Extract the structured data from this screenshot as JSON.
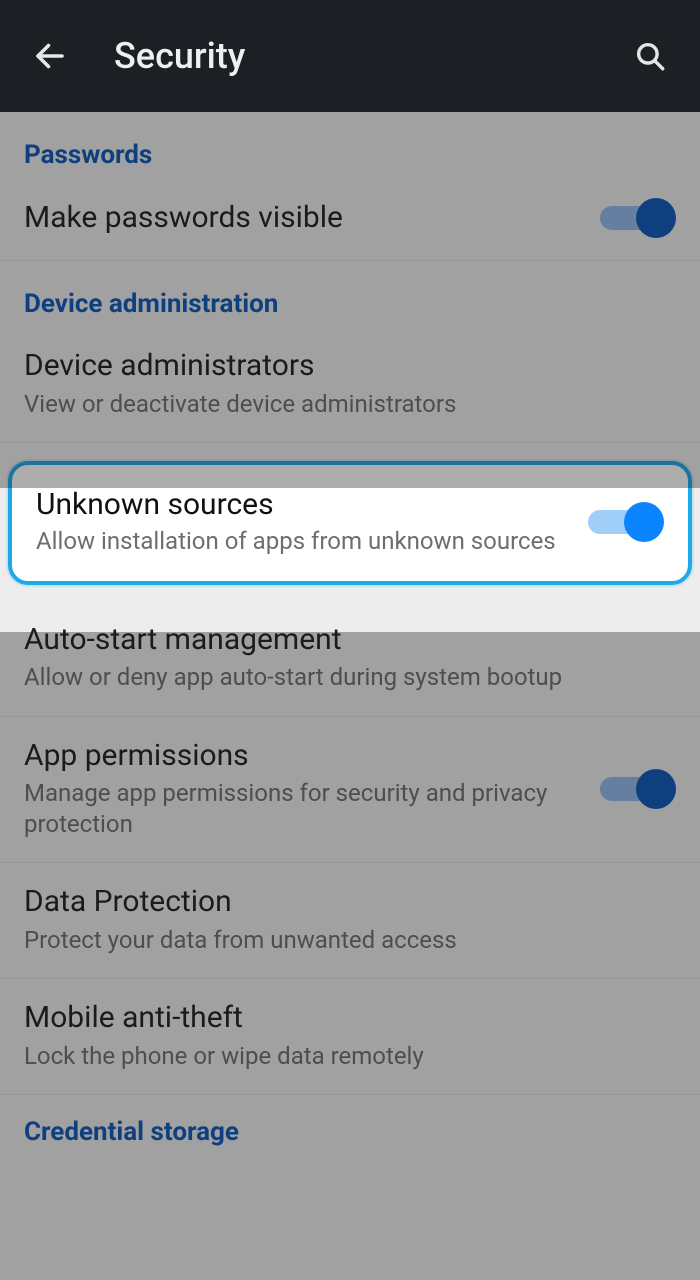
{
  "appbar": {
    "title": "Security"
  },
  "sections": {
    "passwords": {
      "label": "Passwords",
      "make_visible": {
        "title": "Make passwords visible"
      }
    },
    "device_admin": {
      "label": "Device administration",
      "administrators": {
        "title": "Device administrators",
        "subtitle": "View or deactivate device administrators"
      },
      "unknown_sources": {
        "title": "Unknown sources",
        "subtitle": "Allow installation of apps from unknown sources"
      },
      "autostart": {
        "title": "Auto-start management",
        "subtitle": "Allow or deny app auto-start during system bootup"
      },
      "app_permissions": {
        "title": "App permissions",
        "subtitle": "Manage app permissions for security and privacy protection"
      },
      "data_protection": {
        "title": "Data Protection",
        "subtitle": "Protect your data from unwanted access"
      },
      "mobile_antitheft": {
        "title": "Mobile anti-theft",
        "subtitle": "Lock the phone or wipe data remotely"
      }
    },
    "credential_storage": {
      "label": "Credential storage"
    }
  },
  "colors": {
    "accent": "#0b57b8",
    "highlight_border": "#1fa8e8",
    "toggle_on_thumb": "#0b57b8",
    "toggle_on_track": "#8fb9ea"
  }
}
